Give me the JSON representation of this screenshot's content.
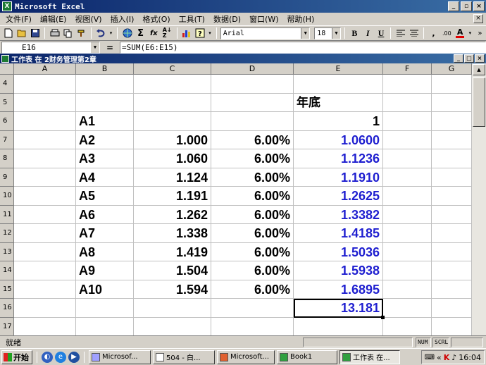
{
  "window": {
    "title": "Microsoft Excel",
    "btn_min": "_",
    "btn_restore": "▫",
    "btn_close": "×"
  },
  "menu": [
    "文件(F)",
    "编辑(E)",
    "视图(V)",
    "插入(I)",
    "格式(O)",
    "工具(T)",
    "数据(D)",
    "窗口(W)",
    "帮助(H)"
  ],
  "toolbar": {
    "font_name": "Arial",
    "font_size": "18",
    "bold": "B",
    "italic": "I",
    "underline": "U"
  },
  "formula_bar": {
    "name_box": "E16",
    "equals": "=",
    "formula": "=SUM(E6:E15)"
  },
  "workbook": {
    "title": "工作表 在 2财务管理第2章"
  },
  "sheet": {
    "columns": [
      "A",
      "B",
      "C",
      "D",
      "E",
      "F",
      "G"
    ],
    "rows": [
      {
        "n": "4",
        "B": "",
        "C": "",
        "D": "",
        "E": ""
      },
      {
        "n": "5",
        "B": "",
        "C": "",
        "D": "",
        "E": "年底"
      },
      {
        "n": "6",
        "B": "A1",
        "C": "",
        "D": "",
        "E": "1"
      },
      {
        "n": "7",
        "B": "A2",
        "C": "1.000",
        "D": "6.00%",
        "E": "1.0600"
      },
      {
        "n": "8",
        "B": "A3",
        "C": "1.060",
        "D": "6.00%",
        "E": "1.1236"
      },
      {
        "n": "9",
        "B": "A4",
        "C": "1.124",
        "D": "6.00%",
        "E": "1.1910"
      },
      {
        "n": "10",
        "B": "A5",
        "C": "1.191",
        "D": "6.00%",
        "E": "1.2625"
      },
      {
        "n": "11",
        "B": "A6",
        "C": "1.262",
        "D": "6.00%",
        "E": "1.3382"
      },
      {
        "n": "12",
        "B": "A7",
        "C": "1.338",
        "D": "6.00%",
        "E": "1.4185"
      },
      {
        "n": "13",
        "B": "A8",
        "C": "1.419",
        "D": "6.00%",
        "E": "1.5036"
      },
      {
        "n": "14",
        "B": "A9",
        "C": "1.504",
        "D": "6.00%",
        "E": "1.5938"
      },
      {
        "n": "15",
        "B": "A10",
        "C": "1.594",
        "D": "6.00%",
        "E": "1.6895"
      },
      {
        "n": "16",
        "B": "",
        "C": "",
        "D": "",
        "E": "13.181"
      },
      {
        "n": "17",
        "B": "",
        "C": "",
        "D": "",
        "E": ""
      }
    ],
    "selected_cell": "E16",
    "value_color": "#1f1fd0"
  },
  "status": {
    "text": "就绪",
    "num": "NUM",
    "scrl": "SCRL"
  },
  "taskbar": {
    "start": "开始",
    "tasks": [
      "Microsof...",
      "504 - 白...",
      "Microsoft...",
      "Book1",
      "工作表 在..."
    ],
    "clock": "16:04"
  }
}
